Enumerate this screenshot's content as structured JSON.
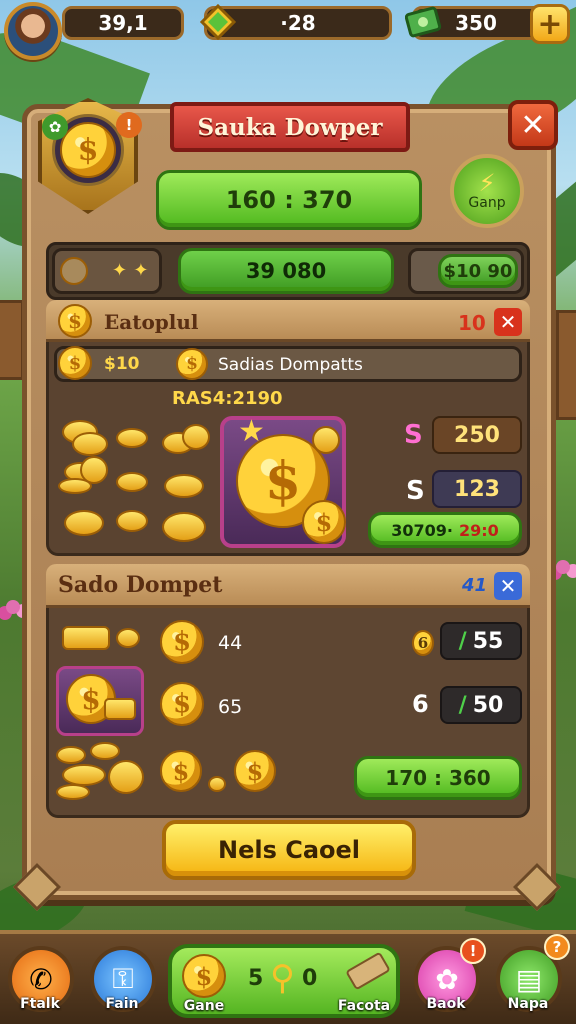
{
  "top_bar": {
    "level_value": "39,1",
    "gems_value": "·28",
    "cash_value": "350"
  },
  "dialog": {
    "title": "Sauka Dowper",
    "main_button": "160 : 370",
    "side_button_label": "Ganp",
    "info_row": {
      "left": "✦ ✦",
      "middle": "39 080",
      "right": "$10 90"
    }
  },
  "section_one": {
    "header": "Eatoplul",
    "header_count": "10",
    "sub_label": "Sadias Dompatts",
    "sub_amount": "$10",
    "promo_text": "RAS4:2190",
    "rows": [
      {
        "icon": "S",
        "value": "250"
      },
      {
        "icon": "S",
        "value": "123"
      }
    ],
    "action_button_left": "30709·",
    "action_button_right": "29:0"
  },
  "section_two": {
    "header": "Sado Dompet",
    "header_count": "41",
    "items": [
      {
        "label": "44",
        "icon": "6",
        "value": "55"
      },
      {
        "label": "65",
        "icon": "6",
        "value": "50"
      }
    ],
    "action_button": "170 : 360"
  },
  "footer_button": "Nels Caoel",
  "bottom_nav": {
    "items": [
      {
        "label": "Ftalk"
      },
      {
        "label": "Fain"
      },
      {
        "label": "Gane",
        "value": "5",
        "value2": "0"
      },
      {
        "label": "Facota"
      },
      {
        "label": "Baok"
      },
      {
        "label": "Napa"
      }
    ],
    "badge_book": "!",
    "badge_map": "?"
  },
  "colors": {
    "panel": "#b99062",
    "green": "#55b522",
    "red": "#c33818",
    "gold": "#ffd23a"
  }
}
